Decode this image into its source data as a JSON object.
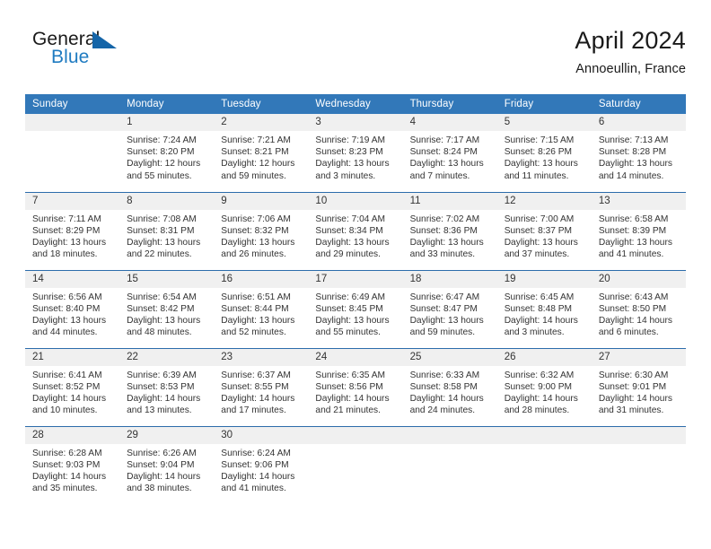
{
  "brand": {
    "name_top": "General",
    "name_bottom": "Blue",
    "triangle_icon": "blue-triangle-icon",
    "colors": {
      "text": "#1a1a1a",
      "blue": "#1f7bc1",
      "triangle": "#1565a8"
    }
  },
  "header": {
    "title": "April 2024",
    "subtitle": "Annoeullin, France"
  },
  "theme": {
    "header_bg": "#3278b9",
    "row_divider": "#2c6cab",
    "daynum_bg": "#f0f0f0",
    "page_bg": "#ffffff"
  },
  "calendar": {
    "weekday_headers": [
      "Sunday",
      "Monday",
      "Tuesday",
      "Wednesday",
      "Thursday",
      "Friday",
      "Saturday"
    ],
    "weeks": [
      [
        {
          "day": ""
        },
        {
          "day": "1",
          "sunrise": "Sunrise: 7:24 AM",
          "sunset": "Sunset: 8:20 PM",
          "daylight_1": "Daylight: 12 hours",
          "daylight_2": "and 55 minutes."
        },
        {
          "day": "2",
          "sunrise": "Sunrise: 7:21 AM",
          "sunset": "Sunset: 8:21 PM",
          "daylight_1": "Daylight: 12 hours",
          "daylight_2": "and 59 minutes."
        },
        {
          "day": "3",
          "sunrise": "Sunrise: 7:19 AM",
          "sunset": "Sunset: 8:23 PM",
          "daylight_1": "Daylight: 13 hours",
          "daylight_2": "and 3 minutes."
        },
        {
          "day": "4",
          "sunrise": "Sunrise: 7:17 AM",
          "sunset": "Sunset: 8:24 PM",
          "daylight_1": "Daylight: 13 hours",
          "daylight_2": "and 7 minutes."
        },
        {
          "day": "5",
          "sunrise": "Sunrise: 7:15 AM",
          "sunset": "Sunset: 8:26 PM",
          "daylight_1": "Daylight: 13 hours",
          "daylight_2": "and 11 minutes."
        },
        {
          "day": "6",
          "sunrise": "Sunrise: 7:13 AM",
          "sunset": "Sunset: 8:28 PM",
          "daylight_1": "Daylight: 13 hours",
          "daylight_2": "and 14 minutes."
        }
      ],
      [
        {
          "day": "7",
          "sunrise": "Sunrise: 7:11 AM",
          "sunset": "Sunset: 8:29 PM",
          "daylight_1": "Daylight: 13 hours",
          "daylight_2": "and 18 minutes."
        },
        {
          "day": "8",
          "sunrise": "Sunrise: 7:08 AM",
          "sunset": "Sunset: 8:31 PM",
          "daylight_1": "Daylight: 13 hours",
          "daylight_2": "and 22 minutes."
        },
        {
          "day": "9",
          "sunrise": "Sunrise: 7:06 AM",
          "sunset": "Sunset: 8:32 PM",
          "daylight_1": "Daylight: 13 hours",
          "daylight_2": "and 26 minutes."
        },
        {
          "day": "10",
          "sunrise": "Sunrise: 7:04 AM",
          "sunset": "Sunset: 8:34 PM",
          "daylight_1": "Daylight: 13 hours",
          "daylight_2": "and 29 minutes."
        },
        {
          "day": "11",
          "sunrise": "Sunrise: 7:02 AM",
          "sunset": "Sunset: 8:36 PM",
          "daylight_1": "Daylight: 13 hours",
          "daylight_2": "and 33 minutes."
        },
        {
          "day": "12",
          "sunrise": "Sunrise: 7:00 AM",
          "sunset": "Sunset: 8:37 PM",
          "daylight_1": "Daylight: 13 hours",
          "daylight_2": "and 37 minutes."
        },
        {
          "day": "13",
          "sunrise": "Sunrise: 6:58 AM",
          "sunset": "Sunset: 8:39 PM",
          "daylight_1": "Daylight: 13 hours",
          "daylight_2": "and 41 minutes."
        }
      ],
      [
        {
          "day": "14",
          "sunrise": "Sunrise: 6:56 AM",
          "sunset": "Sunset: 8:40 PM",
          "daylight_1": "Daylight: 13 hours",
          "daylight_2": "and 44 minutes."
        },
        {
          "day": "15",
          "sunrise": "Sunrise: 6:54 AM",
          "sunset": "Sunset: 8:42 PM",
          "daylight_1": "Daylight: 13 hours",
          "daylight_2": "and 48 minutes."
        },
        {
          "day": "16",
          "sunrise": "Sunrise: 6:51 AM",
          "sunset": "Sunset: 8:44 PM",
          "daylight_1": "Daylight: 13 hours",
          "daylight_2": "and 52 minutes."
        },
        {
          "day": "17",
          "sunrise": "Sunrise: 6:49 AM",
          "sunset": "Sunset: 8:45 PM",
          "daylight_1": "Daylight: 13 hours",
          "daylight_2": "and 55 minutes."
        },
        {
          "day": "18",
          "sunrise": "Sunrise: 6:47 AM",
          "sunset": "Sunset: 8:47 PM",
          "daylight_1": "Daylight: 13 hours",
          "daylight_2": "and 59 minutes."
        },
        {
          "day": "19",
          "sunrise": "Sunrise: 6:45 AM",
          "sunset": "Sunset: 8:48 PM",
          "daylight_1": "Daylight: 14 hours",
          "daylight_2": "and 3 minutes."
        },
        {
          "day": "20",
          "sunrise": "Sunrise: 6:43 AM",
          "sunset": "Sunset: 8:50 PM",
          "daylight_1": "Daylight: 14 hours",
          "daylight_2": "and 6 minutes."
        }
      ],
      [
        {
          "day": "21",
          "sunrise": "Sunrise: 6:41 AM",
          "sunset": "Sunset: 8:52 PM",
          "daylight_1": "Daylight: 14 hours",
          "daylight_2": "and 10 minutes."
        },
        {
          "day": "22",
          "sunrise": "Sunrise: 6:39 AM",
          "sunset": "Sunset: 8:53 PM",
          "daylight_1": "Daylight: 14 hours",
          "daylight_2": "and 13 minutes."
        },
        {
          "day": "23",
          "sunrise": "Sunrise: 6:37 AM",
          "sunset": "Sunset: 8:55 PM",
          "daylight_1": "Daylight: 14 hours",
          "daylight_2": "and 17 minutes."
        },
        {
          "day": "24",
          "sunrise": "Sunrise: 6:35 AM",
          "sunset": "Sunset: 8:56 PM",
          "daylight_1": "Daylight: 14 hours",
          "daylight_2": "and 21 minutes."
        },
        {
          "day": "25",
          "sunrise": "Sunrise: 6:33 AM",
          "sunset": "Sunset: 8:58 PM",
          "daylight_1": "Daylight: 14 hours",
          "daylight_2": "and 24 minutes."
        },
        {
          "day": "26",
          "sunrise": "Sunrise: 6:32 AM",
          "sunset": "Sunset: 9:00 PM",
          "daylight_1": "Daylight: 14 hours",
          "daylight_2": "and 28 minutes."
        },
        {
          "day": "27",
          "sunrise": "Sunrise: 6:30 AM",
          "sunset": "Sunset: 9:01 PM",
          "daylight_1": "Daylight: 14 hours",
          "daylight_2": "and 31 minutes."
        }
      ],
      [
        {
          "day": "28",
          "sunrise": "Sunrise: 6:28 AM",
          "sunset": "Sunset: 9:03 PM",
          "daylight_1": "Daylight: 14 hours",
          "daylight_2": "and 35 minutes."
        },
        {
          "day": "29",
          "sunrise": "Sunrise: 6:26 AM",
          "sunset": "Sunset: 9:04 PM",
          "daylight_1": "Daylight: 14 hours",
          "daylight_2": "and 38 minutes."
        },
        {
          "day": "30",
          "sunrise": "Sunrise: 6:24 AM",
          "sunset": "Sunset: 9:06 PM",
          "daylight_1": "Daylight: 14 hours",
          "daylight_2": "and 41 minutes."
        },
        {
          "day": ""
        },
        {
          "day": ""
        },
        {
          "day": ""
        },
        {
          "day": ""
        }
      ]
    ]
  }
}
